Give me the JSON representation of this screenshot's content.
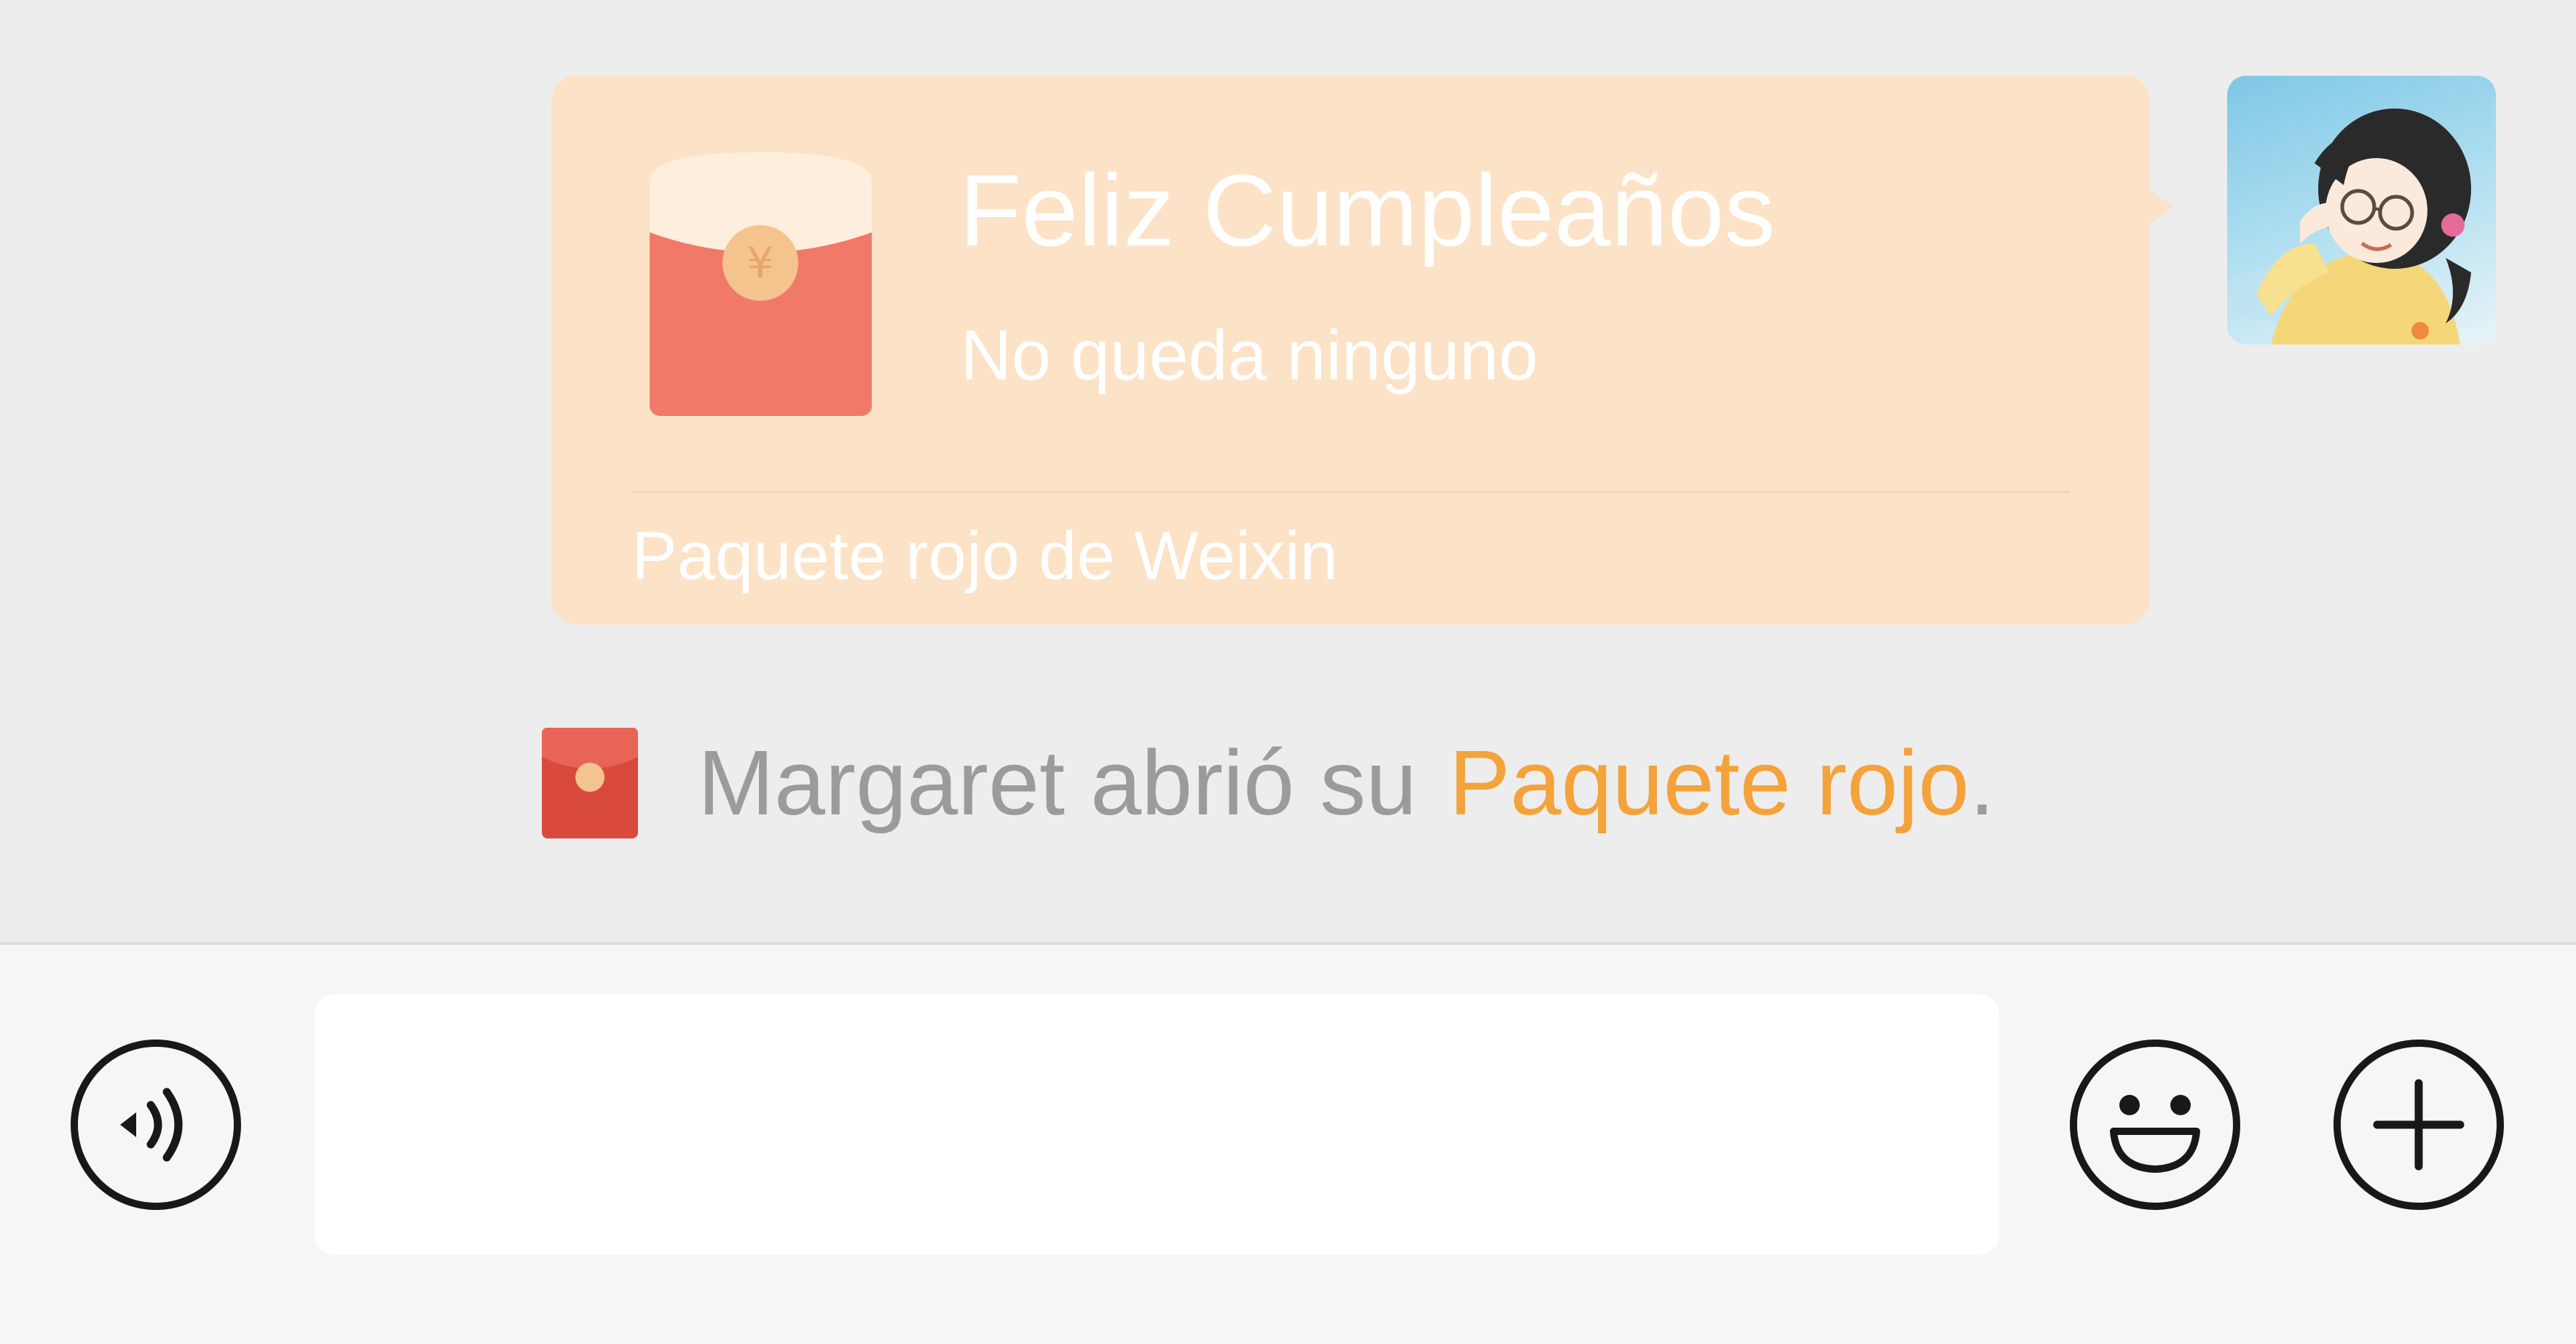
{
  "message": {
    "red_packet": {
      "title": "Feliz Cumpleaños",
      "subtitle": "No queda ninguno",
      "footer": "Paquete rojo de Weixin",
      "bubble_color": "#fce2c6",
      "envelope_color": "#f07a67",
      "envelope_icon": "red-envelope-icon"
    },
    "avatar": {
      "icon": "user-avatar-illustration"
    }
  },
  "notice": {
    "icon": "small-red-packet-icon",
    "text": "Margaret abrió su",
    "link": "Paquete rojo",
    "period": ".",
    "link_color": "#f4a23a"
  },
  "input_bar": {
    "voice_icon": "voice-icon",
    "input_value": "",
    "emoji_icon": "emoji-icon",
    "plus_icon": "plus-icon"
  }
}
